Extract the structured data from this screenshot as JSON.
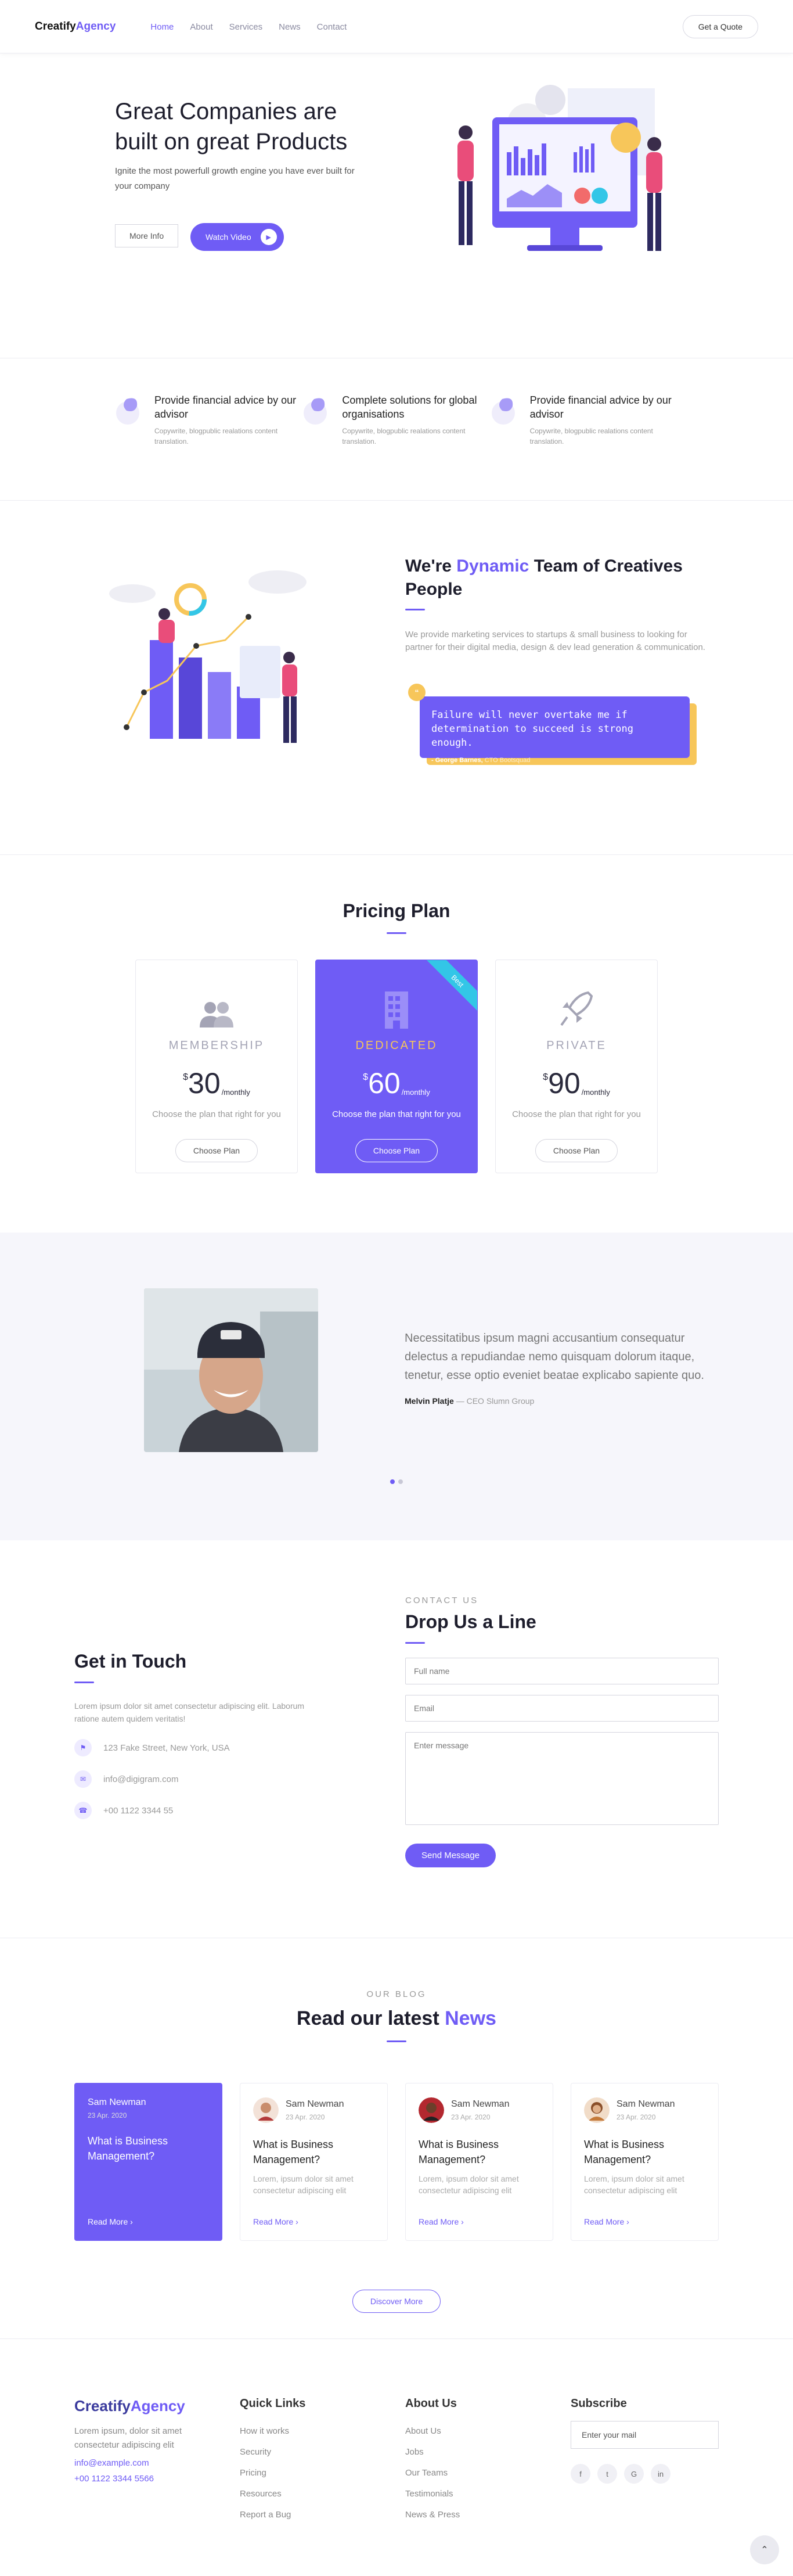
{
  "header": {
    "logo_main": "Creatify",
    "logo_accent": "Agency",
    "nav": [
      "Home",
      "About",
      "Services",
      "News",
      "Contact"
    ],
    "quote_label": "Get a Quote"
  },
  "hero": {
    "title": "Great Companies are built on great Products",
    "subtitle": "Ignite the most powerfull growth engine you have ever built for your company",
    "more_label": "More Info",
    "video_label": "Watch Video"
  },
  "features": [
    {
      "title": "Provide financial advice by our advisor",
      "desc": "Copywrite, blogpublic realations content translation."
    },
    {
      "title": "Complete solutions for global organisations",
      "desc": "Copywrite, blogpublic realations content translation."
    },
    {
      "title": "Provide financial advice by our advisor",
      "desc": "Copywrite, blogpublic realations content translation."
    }
  ],
  "team": {
    "title_pre": "We're ",
    "title_accent": "Dynamic",
    "title_post": " Team of Creatives People",
    "text": "We provide marketing services to startups & small business to looking for partner for their digital media, design & dev lead generation & communication.",
    "quote": "Failure will never overtake me if determination to succeed is strong enough.",
    "quote_author": "- George Barnes,",
    "quote_role": "CTO Bootsquad",
    "quote_badge": "“"
  },
  "pricing": {
    "title": "Pricing Plan",
    "ribbon": "Best",
    "plans": [
      {
        "name": "MEMBERSHIP",
        "currency": "$",
        "amount": "30",
        "period": "/monthly",
        "desc": "Choose the plan that right for you",
        "button": "Choose Plan"
      },
      {
        "name": "DEDICATED",
        "currency": "$",
        "amount": "60",
        "period": "/monthly",
        "desc": "Choose the plan that right for you",
        "button": "Choose Plan"
      },
      {
        "name": "PRIVATE",
        "currency": "$",
        "amount": "90",
        "period": "/monthly",
        "desc": "Choose the plan that right for you",
        "button": "Choose Plan"
      }
    ]
  },
  "testimonial": {
    "text": "Necessitatibus ipsum magni accusantium consequatur delectus a repudiandae nemo quisquam dolorum itaque, tenetur, esse optio eveniet beatae explicabo sapiente quo.",
    "author": "Melvin Platje",
    "role": " — CEO Slumn Group"
  },
  "contact": {
    "left_title": "Get in Touch",
    "left_text": "Lorem ipsum dolor sit amet consectetur adipiscing elit. Laborum ratione autem quidem veritatis!",
    "address": "123 Fake Street, New York, USA",
    "email": "info@digigram.com",
    "phone": "+00 1122 3344 55",
    "eyebrow": "CONTACT US",
    "right_title": "Drop Us a Line",
    "name_ph": "Full name",
    "email_ph": "Email",
    "msg_ph": "Enter message",
    "send_label": "Send Message"
  },
  "blog": {
    "eyebrow": "OUR BLOG",
    "title_pre": "Read our latest ",
    "title_accent": "News",
    "discover": "Discover More",
    "posts": [
      {
        "author": "Sam Newman",
        "date": "23 Apr. 2020",
        "title": "What is Business Management?",
        "excerpt": "",
        "more": "Read More"
      },
      {
        "author": "Sam Newman",
        "date": "23 Apr. 2020",
        "title": "What is Business Management?",
        "excerpt": "Lorem, ipsum dolor sit amet consectetur adipiscing elit",
        "more": "Read More"
      },
      {
        "author": "Sam Newman",
        "date": "23 Apr. 2020",
        "title": "What is Business Management?",
        "excerpt": "Lorem, ipsum dolor sit amet consectetur adipiscing elit",
        "more": "Read More"
      },
      {
        "author": "Sam Newman",
        "date": "23 Apr. 2020",
        "title": "What is Business Management?",
        "excerpt": "Lorem, ipsum dolor sit amet consectetur adipiscing elit",
        "more": "Read More"
      }
    ]
  },
  "footer": {
    "logo_main": "Creatify",
    "logo_accent": "Agency",
    "desc": "Lorem ipsum, dolor sit amet consectetur adipiscing elit",
    "email": "info@example.com",
    "phone": "+00 1122 3344 5566",
    "quick_title": "Quick Links",
    "quick_links": [
      "How it works",
      "Security",
      "Pricing",
      "Resources",
      "Report a Bug"
    ],
    "about_title": "About Us",
    "about_links": [
      "About Us",
      "Jobs",
      "Our Teams",
      "Testimonials",
      "News & Press"
    ],
    "subscribe_title": "Subscribe",
    "subscribe_ph": "Enter your mail",
    "socials": [
      "f",
      "t",
      "G",
      "in"
    ]
  },
  "colors": {
    "accent": "#6f5cf5",
    "yellow": "#f7c65a",
    "ribbon": "#33c6e7"
  }
}
